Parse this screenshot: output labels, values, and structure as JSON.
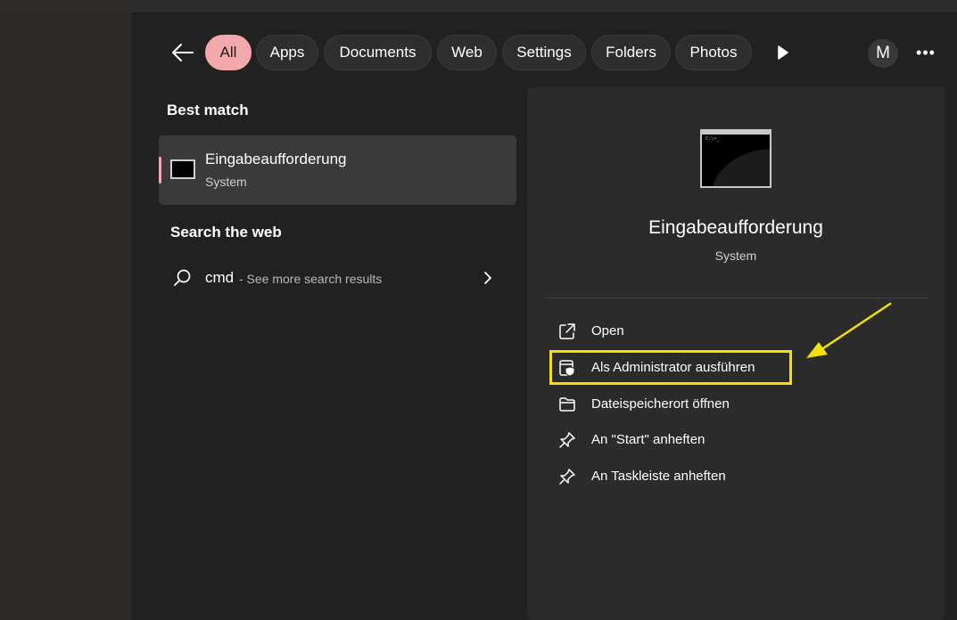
{
  "filter_bar": {
    "tabs": [
      "All",
      "Apps",
      "Documents",
      "Web",
      "Settings",
      "Folders",
      "Photos"
    ],
    "active_tab": "All",
    "avatar_initial": "M",
    "more_label": "•••"
  },
  "results": {
    "best_match_heading": "Best match",
    "best_match": {
      "title": "Eingabeaufforderung",
      "subtitle": "System",
      "icon": "cmd-icon"
    },
    "web_heading": "Search the web",
    "web_result": {
      "query": "cmd",
      "suffix": "- See more search results"
    }
  },
  "detail": {
    "title": "Eingabeaufforderung",
    "subtitle": "System",
    "actions": [
      {
        "label": "Open",
        "icon": "open-external-icon"
      },
      {
        "label": "Als Administrator ausführen",
        "icon": "run-as-admin-icon",
        "highlighted": true
      },
      {
        "label": "Dateispeicherort öffnen",
        "icon": "folder-icon"
      },
      {
        "label": "An \"Start\" anheften",
        "icon": "pin-icon"
      },
      {
        "label": "An Taskleiste anheften",
        "icon": "pin-icon"
      }
    ]
  },
  "colors": {
    "accent": "#f3a9ab",
    "highlight": "#f5e000",
    "panel": "#212121",
    "detail": "#2b2b2b"
  }
}
